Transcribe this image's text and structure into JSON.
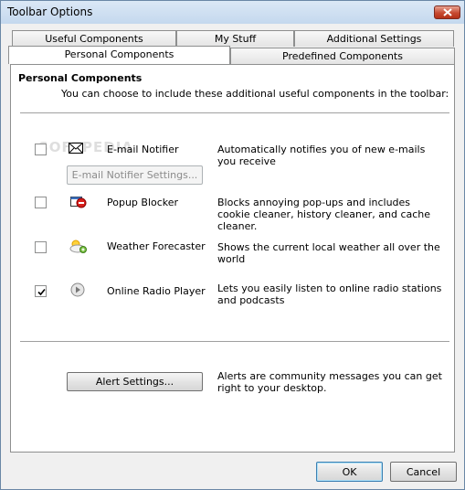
{
  "window": {
    "title": "Toolbar Options"
  },
  "tabs": {
    "row1": [
      {
        "label": "Useful Components"
      },
      {
        "label": "My Stuff"
      },
      {
        "label": "Additional Settings"
      }
    ],
    "row2": [
      {
        "label": "Personal Components",
        "active": true
      },
      {
        "label": "Predefined Components"
      }
    ]
  },
  "panel": {
    "title": "Personal Components",
    "description": "You can choose to include these additional useful components in the toolbar:",
    "watermark": "SOFTPEDIA",
    "components": [
      {
        "name": "E-mail Notifier",
        "icon": "envelope-icon",
        "checked": false,
        "description": "Automatically notifies you of new e-mails you receive",
        "settings_button": "E-mail Notifier Settings..."
      },
      {
        "name": "Popup Blocker",
        "icon": "popup-blocker-icon",
        "checked": false,
        "description": "Blocks annoying pop-ups and includes cookie cleaner, history cleaner, and cache cleaner."
      },
      {
        "name": "Weather Forecaster",
        "icon": "weather-icon",
        "checked": false,
        "description": "Shows the current local weather all over the world"
      },
      {
        "name": "Online Radio Player",
        "icon": "radio-play-icon",
        "checked": true,
        "description": "Lets you easily listen to online radio stations and podcasts"
      }
    ],
    "alerts": {
      "button": "Alert Settings...",
      "description": "Alerts are community messages you can get right to your desktop."
    }
  },
  "footer": {
    "ok": "OK",
    "cancel": "Cancel"
  },
  "colors": {
    "title_bar": "#c4d8ee",
    "close_button": "#c74a31",
    "panel_bg": "#ffffff",
    "dialog_bg": "#f0f0f0"
  }
}
